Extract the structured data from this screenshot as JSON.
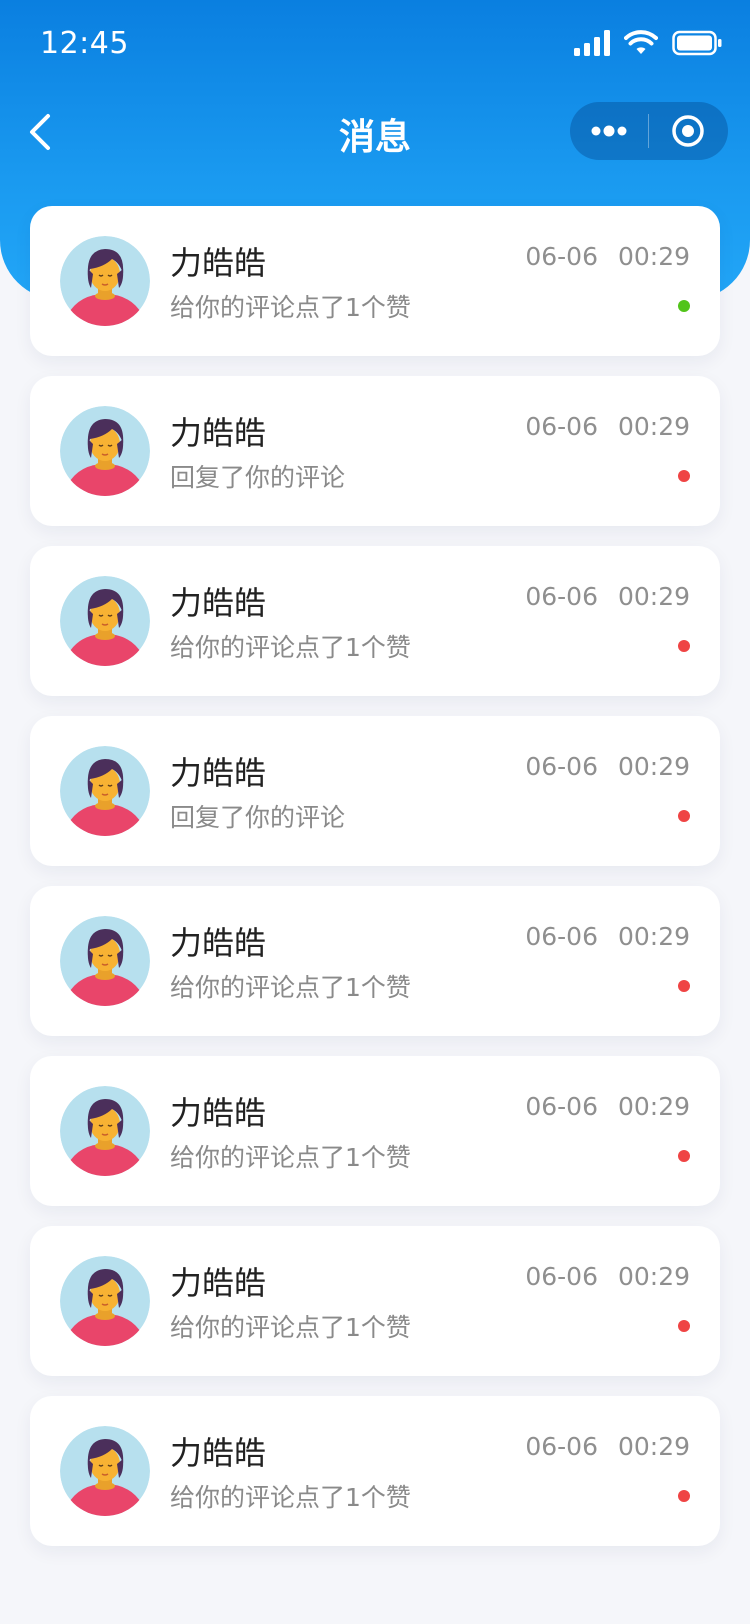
{
  "status": {
    "time": "12:45"
  },
  "nav": {
    "title": "消息"
  },
  "colors": {
    "unread": "#ef4444",
    "online": "#52c41a",
    "header_top": "#0a7fe0",
    "header_bottom": "#22a6f7"
  },
  "messages": [
    {
      "name": "力皓皓",
      "text": "给你的评论点了1个赞",
      "date": "06-06",
      "clock": "00:29",
      "dot": "green"
    },
    {
      "name": "力皓皓",
      "text": "回复了你的评论",
      "date": "06-06",
      "clock": "00:29",
      "dot": "red"
    },
    {
      "name": "力皓皓",
      "text": "给你的评论点了1个赞",
      "date": "06-06",
      "clock": "00:29",
      "dot": "red"
    },
    {
      "name": "力皓皓",
      "text": "回复了你的评论",
      "date": "06-06",
      "clock": "00:29",
      "dot": "red"
    },
    {
      "name": "力皓皓",
      "text": "给你的评论点了1个赞",
      "date": "06-06",
      "clock": "00:29",
      "dot": "red"
    },
    {
      "name": "力皓皓",
      "text": "给你的评论点了1个赞",
      "date": "06-06",
      "clock": "00:29",
      "dot": "red"
    },
    {
      "name": "力皓皓",
      "text": "给你的评论点了1个赞",
      "date": "06-06",
      "clock": "00:29",
      "dot": "red"
    },
    {
      "name": "力皓皓",
      "text": "给你的评论点了1个赞",
      "date": "06-06",
      "clock": "00:29",
      "dot": "red"
    }
  ]
}
